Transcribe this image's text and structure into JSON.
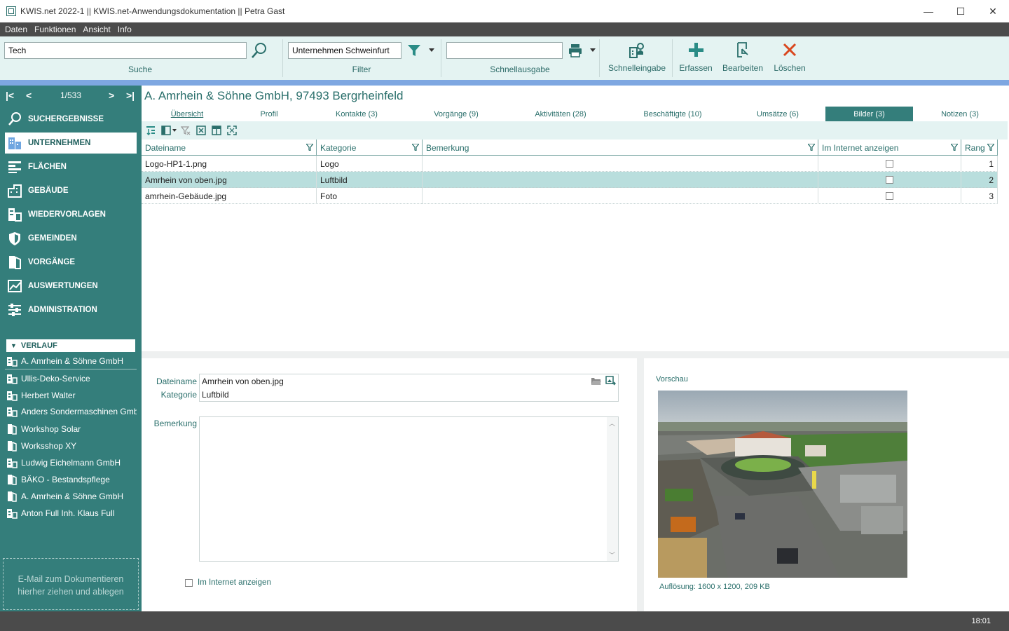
{
  "window": {
    "title": "KWIS.net 2022-1 || KWIS.net-Anwendungsdokumentation || Petra Gast",
    "minimize": "—",
    "maximize": "☐",
    "close": "✕"
  },
  "menu": [
    "Daten",
    "Funktionen",
    "Ansicht",
    "Info"
  ],
  "ribbon": {
    "search_value": "Tech",
    "search_label": "Suche",
    "filter_value": "Unternehmen Schweinfurt",
    "filter_label": "Filter",
    "quick_output_value": "",
    "quick_output_label": "Schnellausgabe",
    "quick_entry_label": "Schnelleingabe",
    "create_label": "Erfassen",
    "edit_label": "Bearbeiten",
    "delete_label": "Löschen"
  },
  "pager": {
    "count": "1/533"
  },
  "nav": [
    {
      "label": "SUCHERGEBNISSE",
      "icon": "search-icon"
    },
    {
      "label": "UNTERNEHMEN",
      "icon": "company-icon"
    },
    {
      "label": "FLÄCHEN",
      "icon": "areas-icon"
    },
    {
      "label": "GEBÄUDE",
      "icon": "buildings-icon"
    },
    {
      "label": "WIEDERVORLAGEN",
      "icon": "resubmission-icon"
    },
    {
      "label": "GEMEINDEN",
      "icon": "municipality-icon"
    },
    {
      "label": "VORGÄNGE",
      "icon": "processes-icon"
    },
    {
      "label": "AUSWERTUNGEN",
      "icon": "reports-icon"
    },
    {
      "label": "ADMINISTRATION",
      "icon": "admin-icon"
    }
  ],
  "history": {
    "title": "VERLAUF",
    "items": [
      "A. Amrhein & Söhne GmbH",
      "Ullis-Deko-Service",
      "Herbert Walter",
      "Anders Sondermaschinen Gmb...",
      "Workshop Solar",
      "Worksshop XY",
      "Ludwig Eichelmann GmbH",
      "BÄKO - Bestandspflege",
      "A. Amrhein & Söhne GmbH",
      "Anton Full Inh. Klaus Full"
    ]
  },
  "dropzone": {
    "line1": "E-Mail  zum Dokumentieren",
    "line2": "hierher ziehen und ablegen"
  },
  "record": {
    "title": "A. Amrhein & Söhne GmbH, 97493 Bergrheinfeld"
  },
  "tabs": [
    "Übersicht",
    "Profil",
    "Kontakte (3)",
    "Vorgänge (9)",
    "Aktivitäten (28)",
    "Beschäftigte (10)",
    "Umsätze (6)",
    "Bilder (3)",
    "Notizen (3)"
  ],
  "grid": {
    "columns": [
      "Dateiname",
      "Kategorie",
      "Bemerkung",
      "Im Internet anzeigen",
      "Rang"
    ],
    "rows": [
      {
        "file": "Logo-HP1-1.png",
        "category": "Logo",
        "remark": "",
        "internet": false,
        "rank": "1"
      },
      {
        "file": "Amrhein von oben.jpg",
        "category": "Luftbild",
        "remark": "",
        "internet": false,
        "rank": "2"
      },
      {
        "file": "amrhein-Gebäude.jpg",
        "category": "Foto",
        "remark": "",
        "internet": false,
        "rank": "3"
      }
    ]
  },
  "detail": {
    "file_label": "Dateiname",
    "file_value": "Amrhein von oben.jpg",
    "category_label": "Kategorie",
    "category_value": "Luftbild",
    "remark_label": "Bemerkung",
    "remark_value": "",
    "internet_label": "Im Internet anzeigen"
  },
  "preview": {
    "label": "Vorschau",
    "resolution": "Auflösung: 1600 x 1200, 209 KB"
  },
  "status": {
    "clock": "18:01"
  },
  "colors": {
    "teal": "#347e7b",
    "ribbon_bg": "#e4f3f2",
    "accent_blue": "#7ea7e1",
    "delete_red": "#d9471e"
  }
}
